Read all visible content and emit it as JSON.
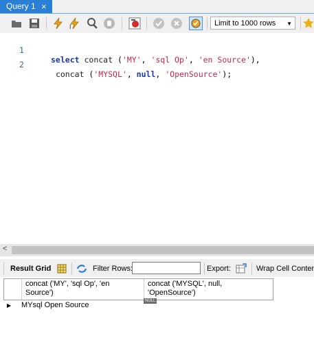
{
  "tab": {
    "title": "Query 1",
    "close_glyph": "×"
  },
  "toolbar": {
    "buttons": [
      "open-folder-icon",
      "save-icon",
      "execute-icon",
      "execute-current-icon",
      "explain-icon",
      "stop-icon",
      "toggle-continue-icon",
      "commit-icon",
      "rollback-icon",
      "autocommit-icon",
      "beautify-icon"
    ],
    "limit_label": "Limit to 1000 rows"
  },
  "editor": {
    "lines": [
      {
        "num": "1",
        "text": "select concat ('MY', 'sql Op', 'en Source'),"
      },
      {
        "num": "2",
        "text": " concat ('MYSQL', null, 'OpenSource');"
      }
    ]
  },
  "result_toolbar": {
    "result_grid": "Result Grid",
    "filter_rows": "Filter Rows:",
    "export": "Export:",
    "wrap": "Wrap Cell Content"
  },
  "grid": {
    "columns": [
      {
        "l1": "concat ('MY', 'sql Op', 'en",
        "l2": "Source')"
      },
      {
        "l1": "concat ('MYSQL', null,",
        "l2": "'OpenSource')"
      }
    ],
    "rows": [
      {
        "c1": "MYsql Open Source",
        "c2_null": "NULL"
      }
    ]
  },
  "colors": {
    "tab_active": "#2b80d6",
    "keyword": "#1a35b0",
    "string": "#c7254e",
    "line_number": "#3369aa"
  }
}
